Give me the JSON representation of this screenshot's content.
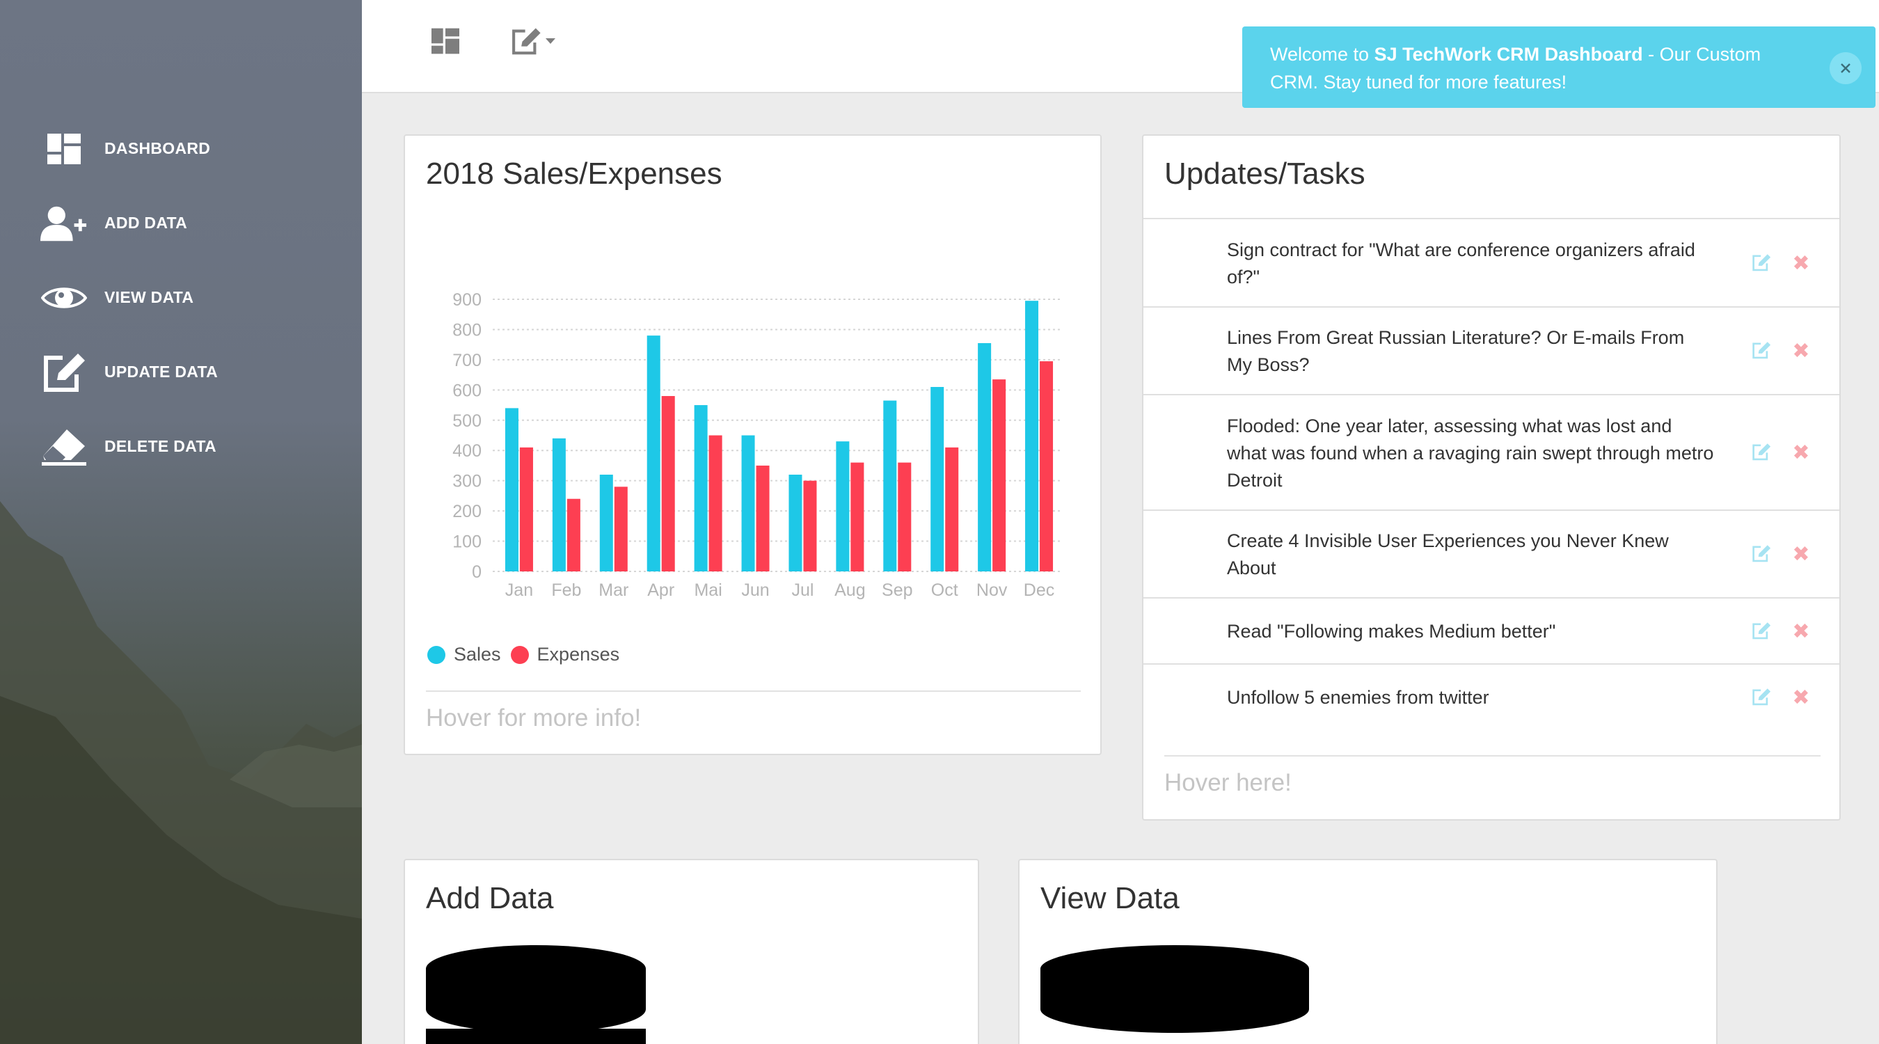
{
  "sidebar": {
    "items": [
      {
        "label": "DASHBOARD",
        "icon": "dashboard-icon"
      },
      {
        "label": "ADD DATA",
        "icon": "add-user-icon"
      },
      {
        "label": "VIEW DATA",
        "icon": "eye-icon"
      },
      {
        "label": "UPDATE DATA",
        "icon": "edit-icon"
      },
      {
        "label": "DELETE DATA",
        "icon": "eraser-icon"
      }
    ]
  },
  "topbar": {
    "dashboard_icon": "dashboard-icon",
    "edit_menu_icon": "edit-icon"
  },
  "toast": {
    "prefix": "Welcome to ",
    "brand": "SJ TechWork CRM Dashboard",
    "suffix": " - Our Custom CRM. Stay tuned for more features!"
  },
  "sales_card": {
    "title": "2018 Sales/Expenses",
    "footer": "Hover for more info!"
  },
  "chart_data": {
    "type": "bar",
    "title": "",
    "categories": [
      "Jan",
      "Feb",
      "Mar",
      "Apr",
      "Mai",
      "Jun",
      "Jul",
      "Aug",
      "Sep",
      "Oct",
      "Nov",
      "Dec"
    ],
    "series": [
      {
        "name": "Sales",
        "color": "#1ec8e7",
        "values": [
          540,
          440,
          320,
          780,
          550,
          450,
          320,
          430,
          565,
          610,
          755,
          895
        ]
      },
      {
        "name": "Expenses",
        "color": "#fd3f52",
        "values": [
          410,
          240,
          280,
          580,
          450,
          350,
          300,
          360,
          360,
          410,
          635,
          695
        ]
      }
    ],
    "yticks": [
      "0",
      "100",
      "200",
      "300",
      "400",
      "500",
      "600",
      "700",
      "800",
      "900"
    ],
    "ylim": [
      0,
      900
    ],
    "grid": true,
    "legend": "bottom-left"
  },
  "tasks_card": {
    "title": "Updates/Tasks",
    "footer": "Hover here!",
    "items": [
      {
        "text": "Sign contract for \"What are conference organizers afraid of?\""
      },
      {
        "text": "Lines From Great Russian Literature? Or E-mails From My Boss?"
      },
      {
        "text": "Flooded: One year later, assessing what was lost and what was found when a ravaging rain swept through metro Detroit"
      },
      {
        "text": "Create 4 Invisible User Experiences you Never Knew About"
      },
      {
        "text": "Read \"Following makes Medium better\""
      },
      {
        "text": "Unfollow 5 enemies from twitter"
      }
    ],
    "delete_glyph": "✖"
  },
  "add_card": {
    "title": "Add Data",
    "icon": "database-icon"
  },
  "view_card": {
    "title": "View Data",
    "icon": "database-icon"
  }
}
